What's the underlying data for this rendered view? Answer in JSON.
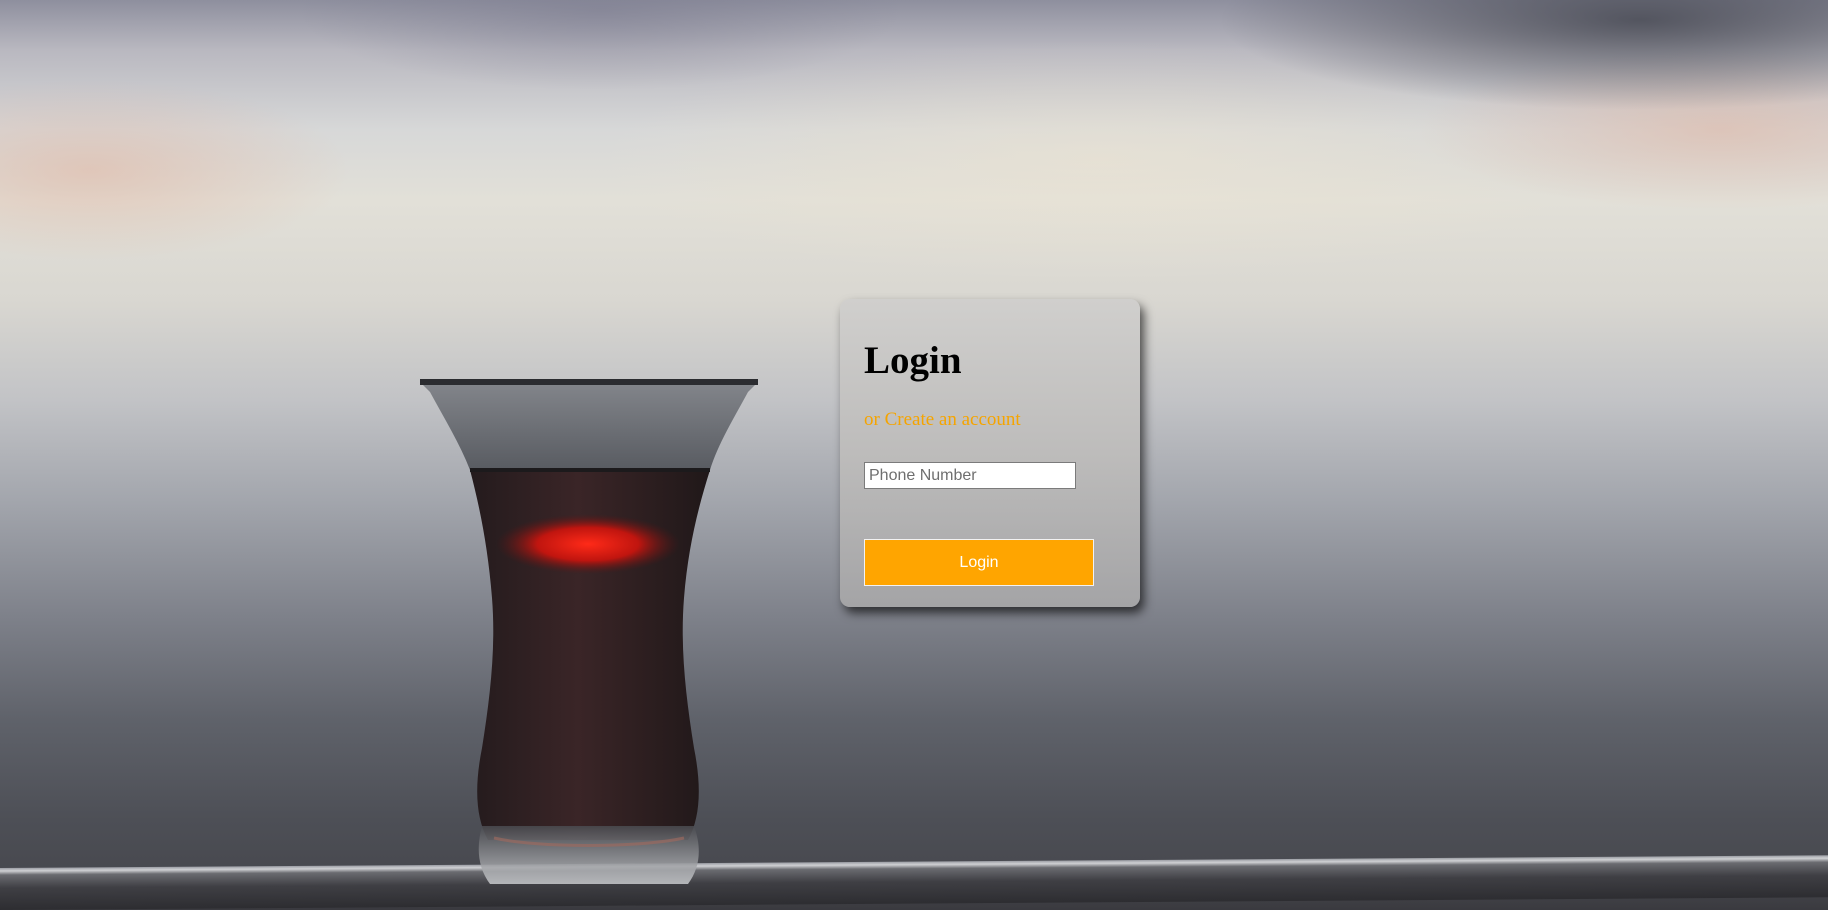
{
  "login": {
    "title": "Login",
    "create_account_link": "or Create an account",
    "phone_placeholder": "Phone Number",
    "phone_value": "",
    "button_label": "Login"
  },
  "colors": {
    "accent": "#ffa500",
    "link": "#f5a400"
  },
  "background": {
    "icon": "tea-glass-photo"
  }
}
